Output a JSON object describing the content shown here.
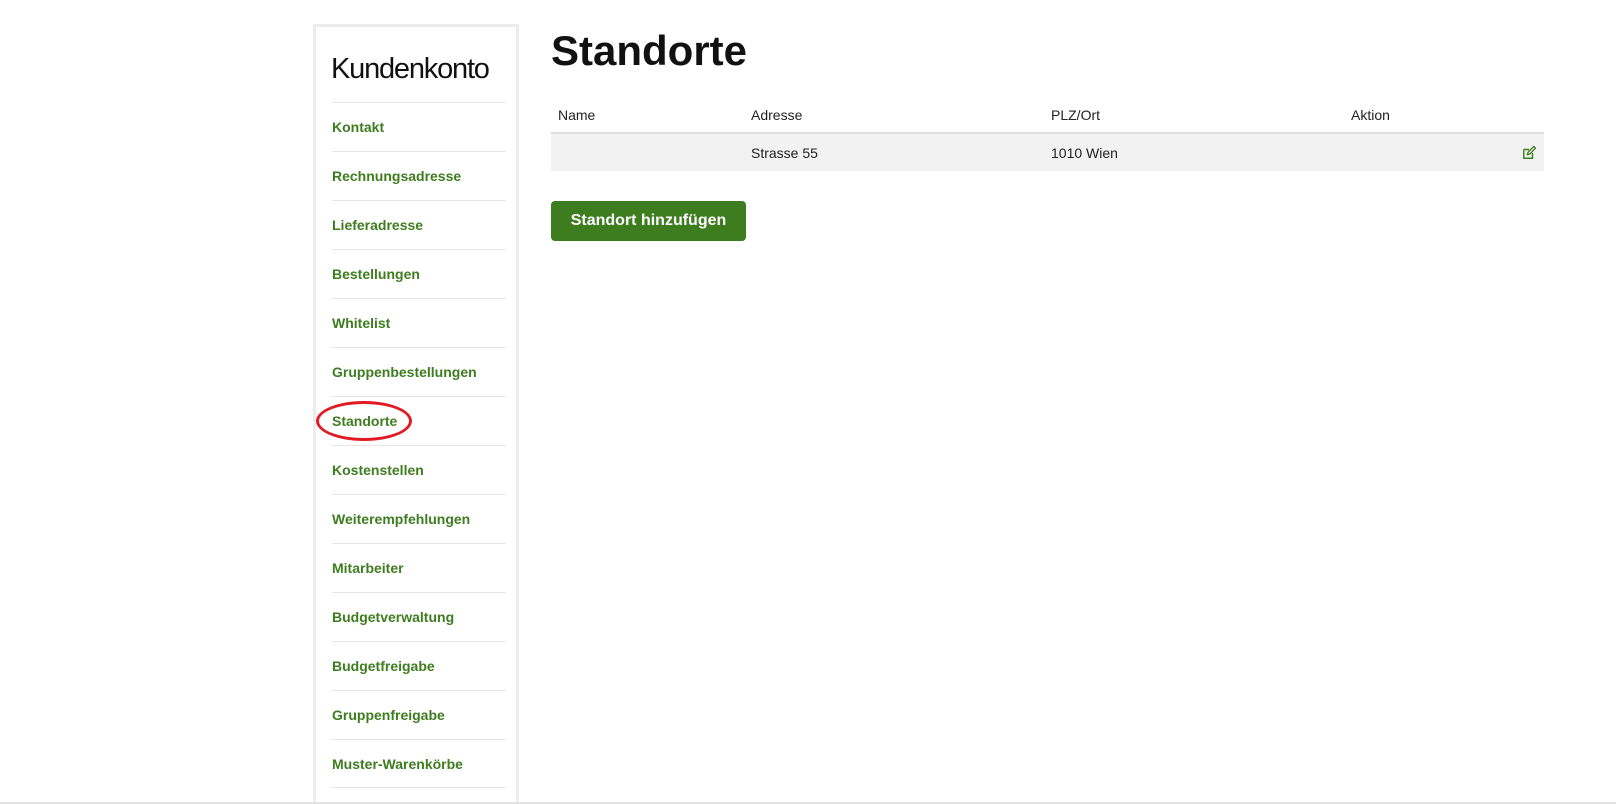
{
  "sidebar": {
    "title": "Kundenkonto",
    "items": [
      {
        "label": "Kontakt"
      },
      {
        "label": "Rechnungsadresse"
      },
      {
        "label": "Lieferadresse"
      },
      {
        "label": "Bestellungen"
      },
      {
        "label": "Whitelist"
      },
      {
        "label": "Gruppenbestellungen"
      },
      {
        "label": "Standorte"
      },
      {
        "label": "Kostenstellen"
      },
      {
        "label": "Weiterempfehlungen"
      },
      {
        "label": "Mitarbeiter"
      },
      {
        "label": "Budgetverwaltung"
      },
      {
        "label": "Budgetfreigabe"
      },
      {
        "label": "Gruppenfreigabe"
      },
      {
        "label": "Muster-Warenkörbe"
      }
    ],
    "active_item": "Standorte"
  },
  "main": {
    "title": "Standorte",
    "table": {
      "headers": [
        "Name",
        "Adresse",
        "PLZ/Ort",
        "Aktion"
      ],
      "rows": [
        {
          "name": "",
          "address": "Strasse 55",
          "city": "1010 Wien",
          "action_icon": "edit-icon"
        }
      ]
    },
    "add_button_label": "Standort hinzufügen"
  },
  "colors": {
    "accent": "#3e7d1f",
    "highlight_circle": "#e01b24",
    "row_background": "#f2f2f2"
  }
}
